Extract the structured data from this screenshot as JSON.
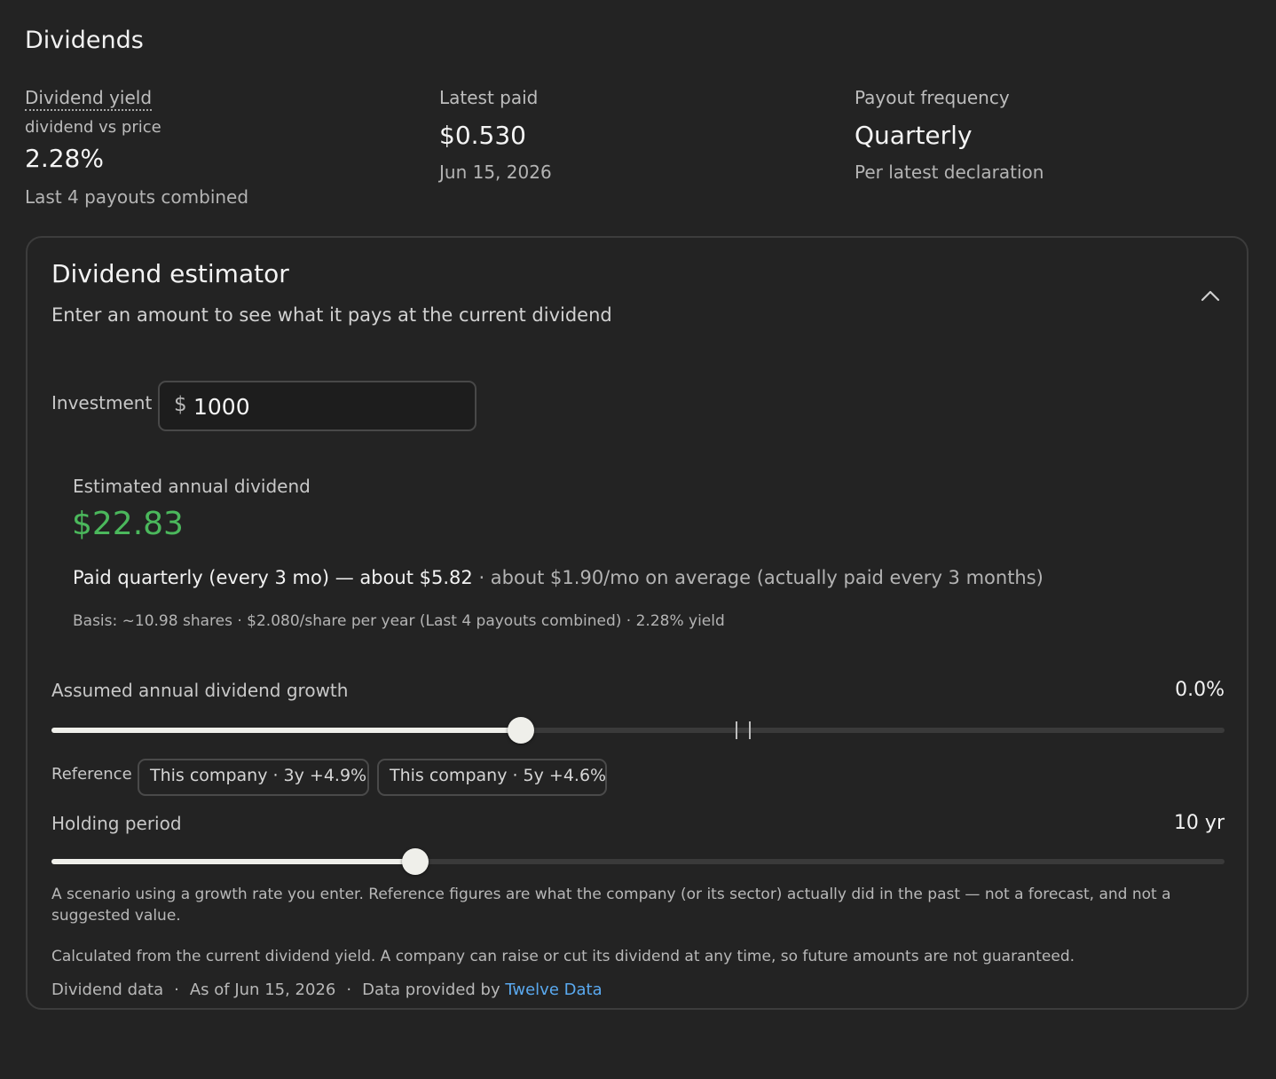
{
  "section_title": "Dividends",
  "stats": {
    "yield": {
      "label": "Dividend yield",
      "sublabel": "dividend vs price",
      "value": "2.28%",
      "note": "Last 4 payouts combined"
    },
    "latest": {
      "label": "Latest paid",
      "value": "$0.530",
      "note": "Jun 15, 2026"
    },
    "frequency": {
      "label": "Payout frequency",
      "value": "Quarterly",
      "note": "Per latest declaration"
    }
  },
  "estimator": {
    "title": "Dividend estimator",
    "subtitle": "Enter an amount to see what it pays at the current dividend",
    "collapse_icon": "chevron-up-icon",
    "investment": {
      "label": "Investment",
      "currency_symbol": "$",
      "value": "1000"
    },
    "estimate": {
      "label": "Estimated annual dividend",
      "value": "$22.83",
      "value_color": "#4bb85c",
      "paid_main": "Paid quarterly (every 3 mo) — about $5.82",
      "paid_muted": " · about $1.90/mo on average (actually paid every 3 months)",
      "basis": "Basis: ~10.98 shares · $2.080/share per year (Last 4 payouts combined) · 2.28% yield"
    },
    "growth": {
      "label": "Assumed annual dividend growth",
      "value": "0.0%",
      "slider_fraction": 0.4
    },
    "reference": {
      "label": "Reference",
      "chips": [
        "This company · 3y +4.9%",
        "This company · 5y +4.6%"
      ]
    },
    "holding": {
      "label": "Holding period",
      "value": "10 yr",
      "slider_fraction": 0.31
    },
    "footnote_1": "A scenario using a growth rate you enter. Reference figures are what the company (or its sector) actually did in the past — not a forecast, and not a suggested value.",
    "footnote_2": "Calculated from the current dividend yield. A company can raise or cut its dividend at any time, so future amounts are not guaranteed.",
    "meta": {
      "source": "Dividend data",
      "as_of": "As of Jun 15, 2026",
      "provided_by": "Data provided by",
      "provider": "Twelve Data",
      "separator": "·"
    }
  }
}
